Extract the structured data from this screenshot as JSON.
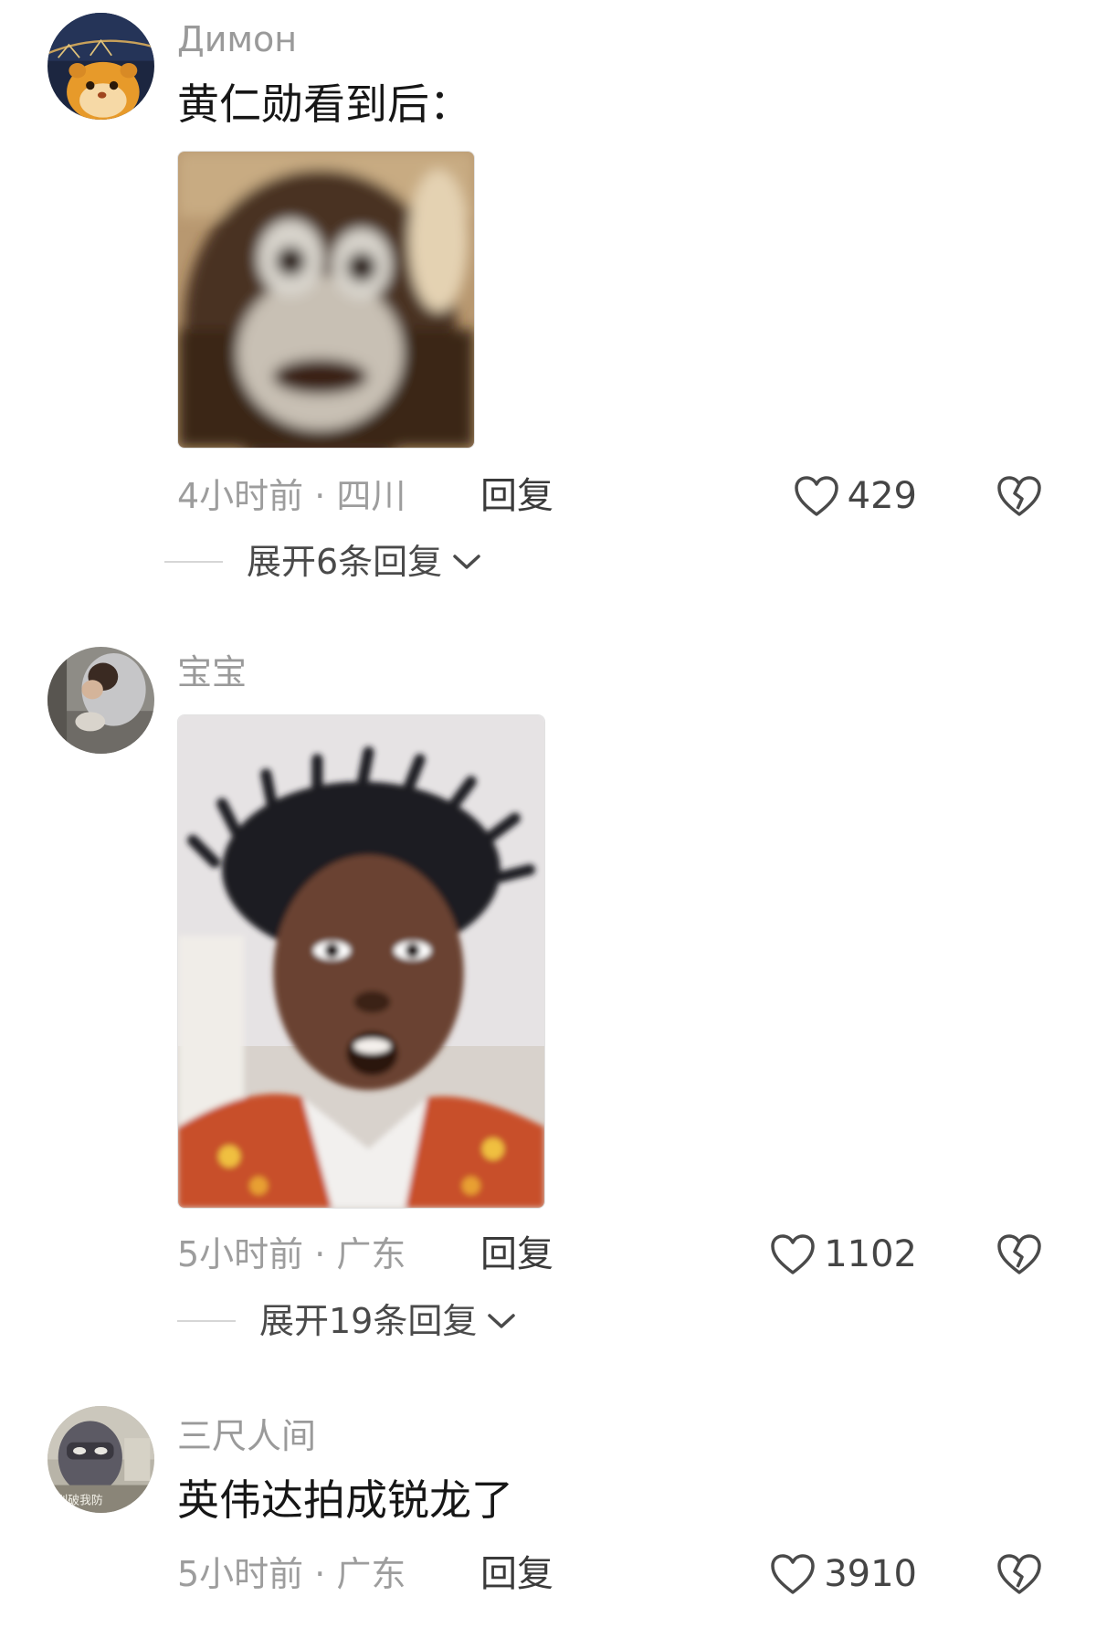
{
  "comments": [
    {
      "username": "Димон",
      "text": "黄仁勋看到后：",
      "time_location": "4小时前 · 四川",
      "reply_label": "回复",
      "likes": "429",
      "expand_label": "展开6条回复"
    },
    {
      "username": "宝宝",
      "time_location": "5小时前 · 广东",
      "reply_label": "回复",
      "likes": "1102",
      "expand_label": "展开19条回复"
    },
    {
      "username": "三尺人间",
      "text": "英伟达拍成锐龙了",
      "time_location": "5小时前 · 广东",
      "reply_label": "回复",
      "likes": "3910",
      "avatar_caption": "别破我防"
    }
  ],
  "colors": {
    "username": "#9a9a9a",
    "text": "#161616",
    "meta": "#9d9d9d",
    "icon": "#4a4a4a"
  },
  "icons": [
    "heart-outline-icon",
    "broken-heart-icon",
    "chevron-down-icon"
  ]
}
